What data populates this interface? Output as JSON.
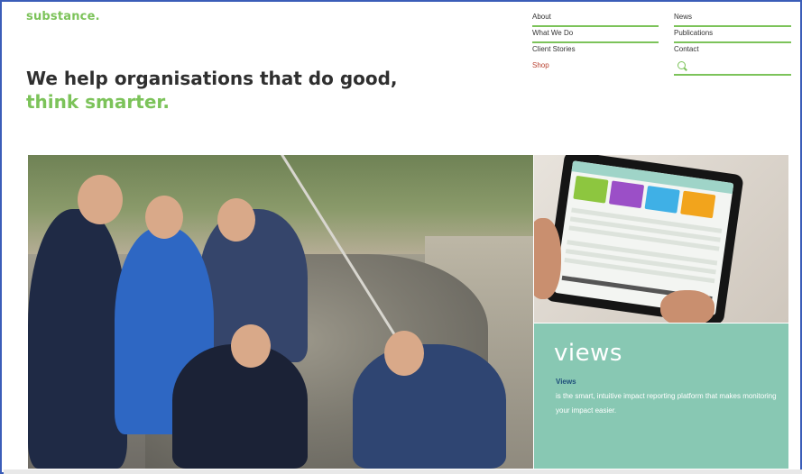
{
  "brand": {
    "logo_text": "substance."
  },
  "hero_text": {
    "line1": "We help organisations that do good,",
    "line2": "think smarter."
  },
  "nav": {
    "col1": [
      "About",
      "What We Do",
      "Client Stories",
      "Shop"
    ],
    "col2": [
      "News",
      "Publications",
      "Contact"
    ]
  },
  "views": {
    "logo": "views",
    "label": "Views",
    "description": "is the smart, intuitive impact reporting platform that makes monitoring your impact easier."
  },
  "colors": {
    "accent_green": "#7cc35a",
    "views_teal": "#88c8b3",
    "frame_blue": "#3b5db8"
  }
}
